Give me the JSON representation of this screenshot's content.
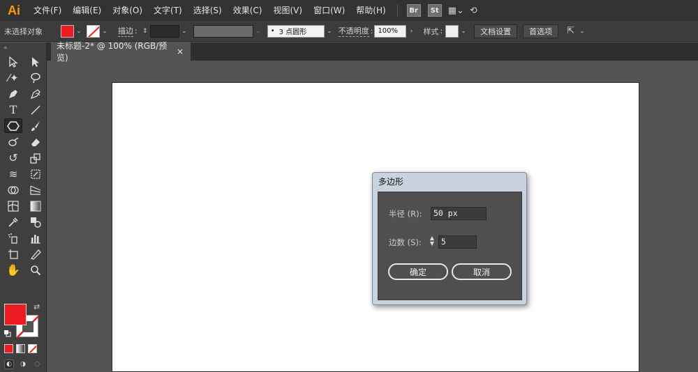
{
  "app": {
    "logo": "Ai"
  },
  "menu": [
    "文件(F)",
    "编辑(E)",
    "对象(O)",
    "文字(T)",
    "选择(S)",
    "效果(C)",
    "视图(V)",
    "窗口(W)",
    "帮助(H)"
  ],
  "menubar_badges": [
    "Br",
    "St"
  ],
  "control": {
    "selection_label": "未选择对象",
    "fill_color": "#ed1c24",
    "stroke_label": "描边",
    "brush_value": "3 点圆形",
    "opacity_label": "不透明度",
    "opacity_value": "100%",
    "style_label": "样式",
    "doc_setup_button": "文档设置",
    "preferences_button": "首选项"
  },
  "tab": {
    "title": "未标题-2* @ 100% (RGB/预览)",
    "close": "×"
  },
  "tools": {
    "fill_color": "#ed1c24",
    "stroke_color": "#ffffff"
  },
  "dialog": {
    "title": "多边形",
    "radius_label": "半径 (R):",
    "radius_value": "50 px",
    "sides_label": "边数 (S):",
    "sides_value": "5",
    "ok_button": "确定",
    "cancel_button": "取消"
  }
}
